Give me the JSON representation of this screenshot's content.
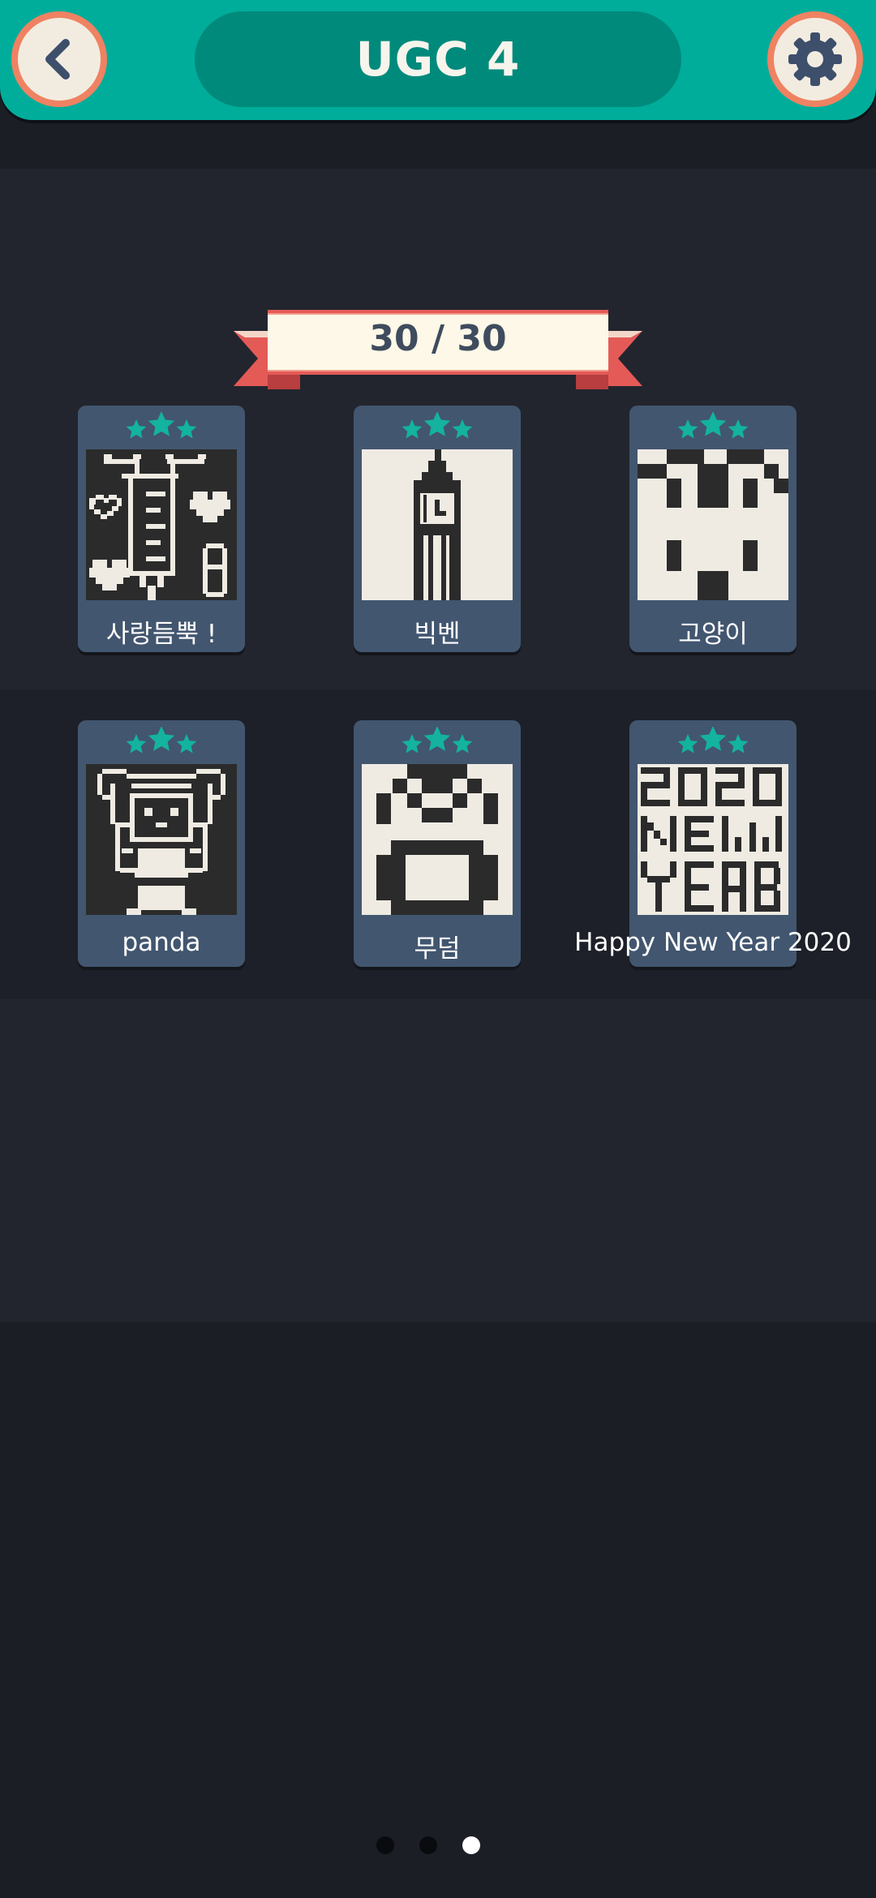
{
  "header": {
    "title": "UGC 4",
    "back_icon": "chevron-left-icon",
    "settings_icon": "gear-icon"
  },
  "progress": {
    "text": "30 / 30",
    "completed": 30,
    "total": 30
  },
  "levels": [
    {
      "name": "사랑듬뿍 !",
      "stars": 3,
      "thumbnail": "syringe-hearts-pixel-art"
    },
    {
      "name": "빅벤",
      "stars": 3,
      "thumbnail": "big-ben-pixel-art"
    },
    {
      "name": "고양이",
      "stars": 3,
      "thumbnail": "cat-face-pixel-art"
    },
    {
      "name": "panda",
      "stars": 3,
      "thumbnail": "panda-girl-pixel-art"
    },
    {
      "name": "무덤",
      "stars": 3,
      "thumbnail": "tomb-pixel-art"
    },
    {
      "name": "Happy New Year 2020",
      "stars": 3,
      "thumbnail": "2020-new-year-pixel-art"
    }
  ],
  "pagination": {
    "pages": 3,
    "current": 3
  },
  "colors": {
    "accent": "#00ad9a",
    "accent_dark": "#008a7c",
    "button_ring": "#ef8262",
    "card": "#42566f",
    "star": "#13b3a0",
    "pixel_light": "#efebe3",
    "pixel_dark": "#2b2b2b"
  }
}
